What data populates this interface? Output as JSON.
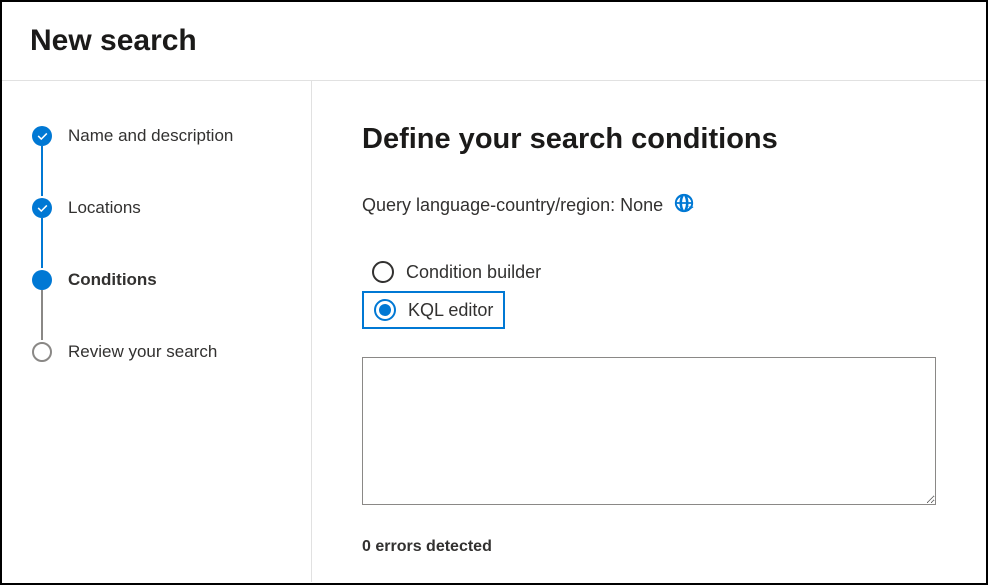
{
  "header": {
    "title": "New search"
  },
  "sidebar": {
    "steps": [
      {
        "label": "Name and description",
        "state": "completed"
      },
      {
        "label": "Locations",
        "state": "completed"
      },
      {
        "label": "Conditions",
        "state": "current"
      },
      {
        "label": "Review your search",
        "state": "pending"
      }
    ]
  },
  "main": {
    "heading": "Define your search conditions",
    "query_language_label": "Query language-country/region: None",
    "options": {
      "condition_builder": "Condition builder",
      "kql_editor": "KQL editor",
      "selected": "kql_editor"
    },
    "editor_value": "",
    "errors_text": "0 errors detected"
  }
}
